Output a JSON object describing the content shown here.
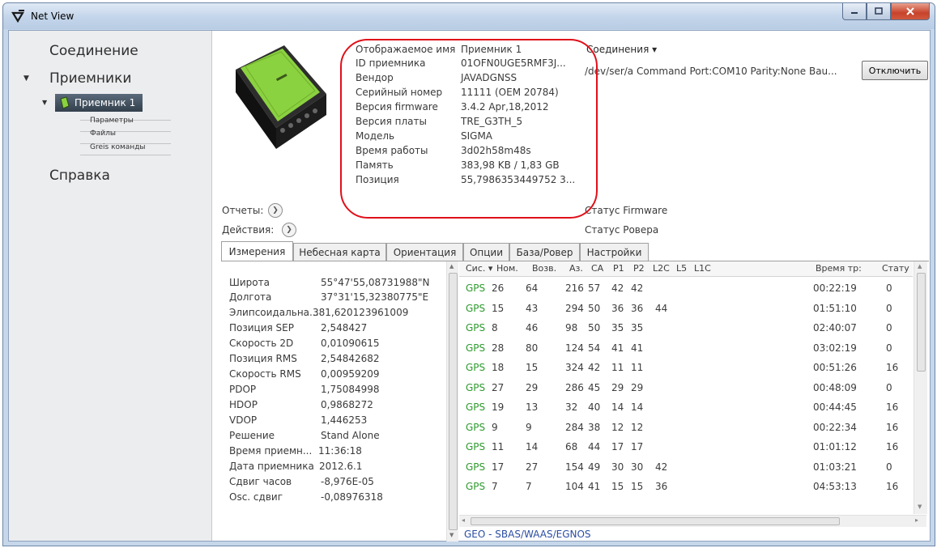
{
  "window": {
    "title": "Net View"
  },
  "sidebar": {
    "items": [
      {
        "label": "Соединение"
      },
      {
        "label": "Приемники"
      },
      {
        "label": "Справка"
      }
    ],
    "receiver": {
      "label": "Приемник 1"
    },
    "subitems": [
      {
        "label": "Параметры"
      },
      {
        "label": "Файлы"
      },
      {
        "label": "Greis команды"
      }
    ]
  },
  "info": {
    "rows": [
      {
        "label": "Отображаемое имя",
        "value": "Приемник 1"
      },
      {
        "label": "ID приемника",
        "value": "01OFN0UGE5RMF3J..."
      },
      {
        "label": "Вендор",
        "value": "JAVADGNSS"
      },
      {
        "label": "Серийный номер",
        "value": "11111 (OEM 20784)"
      },
      {
        "label": "Версия firmware",
        "value": "3.4.2 Apr,18,2012"
      },
      {
        "label": "Версия платы",
        "value": "TRE_G3TH_5"
      },
      {
        "label": "Модель",
        "value": "SIGMA"
      },
      {
        "label": "Время работы",
        "value": "3d02h58m48s"
      },
      {
        "label": "Память",
        "value": "383,98 KB / 1,83 GB"
      },
      {
        "label": "Позиция",
        "value": "55,7986353449752 3..."
      }
    ]
  },
  "connections": {
    "header": "Соединения ▾",
    "value": "/dev/ser/a Command Port:COM10 Parity:None Bau...",
    "disconnect": "Отключить"
  },
  "reports_label": "Отчеты:",
  "actions_label": "Действия:",
  "status_firmware": "Статус Firmware",
  "status_rover": "Статус Ровера",
  "tabs": [
    {
      "label": "Измерения"
    },
    {
      "label": "Небесная карта"
    },
    {
      "label": "Ориентация"
    },
    {
      "label": "Опции"
    },
    {
      "label": "База/Ровер"
    },
    {
      "label": "Настройки"
    }
  ],
  "measurements": [
    {
      "label": "Широта",
      "value": "55°47'55,08731988\"N"
    },
    {
      "label": "Долгота",
      "value": "37°31'15,32380775\"E"
    },
    {
      "label": "Элипсоидальна...",
      "value": "381,620123961009"
    },
    {
      "label": "Позиция SEP",
      "value": "2,548427"
    },
    {
      "label": "Скорость 2D",
      "value": "0,01090615"
    },
    {
      "label": "Позиция RMS",
      "value": "2,54842682"
    },
    {
      "label": "Скорость RMS",
      "value": "0,00959209"
    },
    {
      "label": "PDOP",
      "value": "1,75084998"
    },
    {
      "label": "HDOP",
      "value": "0,9868272"
    },
    {
      "label": "VDOP",
      "value": "1,446253"
    },
    {
      "label": "Решение",
      "value": "Stand Alone"
    },
    {
      "label": "Время приемн...",
      "value": "11:36:18"
    },
    {
      "label": "Дата приемника",
      "value": "2012.6.1"
    },
    {
      "label": "Сдвиг часов",
      "value": "-8,976E-05"
    },
    {
      "label": "Osc. сдвиг",
      "value": "-0,08976318"
    }
  ],
  "grid": {
    "headers": [
      "Сис. ▾",
      "Ном.",
      "Возв.",
      "Аз.",
      "CA",
      "P1",
      "P2",
      "L2C",
      "L5",
      "L1C",
      "Время тр:",
      "Стату"
    ],
    "rows": [
      [
        "GPS",
        "26",
        "64",
        "216",
        "57",
        "42",
        "42",
        "",
        "",
        "",
        "00:22:19",
        "0"
      ],
      [
        "GPS",
        "15",
        "43",
        "294",
        "50",
        "36",
        "36",
        "44",
        "",
        "",
        "01:51:10",
        "0"
      ],
      [
        "GPS",
        "8",
        "46",
        "98",
        "50",
        "35",
        "35",
        "",
        "",
        "",
        "02:40:07",
        "0"
      ],
      [
        "GPS",
        "28",
        "80",
        "124",
        "54",
        "41",
        "41",
        "",
        "",
        "",
        "03:02:19",
        "0"
      ],
      [
        "GPS",
        "18",
        "15",
        "324",
        "42",
        "11",
        "11",
        "",
        "",
        "",
        "00:51:26",
        "16"
      ],
      [
        "GPS",
        "27",
        "29",
        "286",
        "45",
        "29",
        "29",
        "",
        "",
        "",
        "00:48:09",
        "0"
      ],
      [
        "GPS",
        "19",
        "13",
        "32",
        "40",
        "14",
        "14",
        "",
        "",
        "",
        "00:44:45",
        "16"
      ],
      [
        "GPS",
        "9",
        "9",
        "284",
        "38",
        "12",
        "12",
        "",
        "",
        "",
        "00:22:34",
        "16"
      ],
      [
        "GPS",
        "11",
        "14",
        "68",
        "44",
        "17",
        "17",
        "",
        "",
        "",
        "01:01:12",
        "16"
      ],
      [
        "GPS",
        "17",
        "27",
        "154",
        "49",
        "30",
        "30",
        "42",
        "",
        "",
        "01:03:21",
        "0"
      ],
      [
        "GPS",
        "7",
        "7",
        "104",
        "41",
        "15",
        "15",
        "36",
        "",
        "",
        "04:53:13",
        "16"
      ]
    ],
    "footer": "GEO - SBAS/WAAS/EGNOS"
  },
  "colors": {
    "gps_green": "#2e9a2e",
    "highlight_red": "#e0101a",
    "device_green": "#8bd240"
  }
}
